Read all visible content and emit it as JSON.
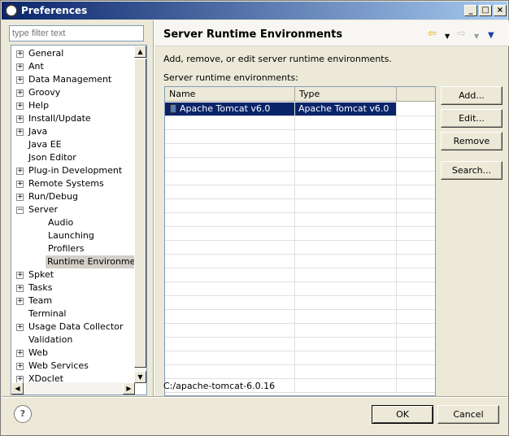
{
  "window": {
    "title": "Preferences",
    "minimize": "_",
    "maximize": "□",
    "close": "×"
  },
  "filter": {
    "placeholder": "type filter text"
  },
  "tree": {
    "items": [
      {
        "label": "General",
        "expander": "+"
      },
      {
        "label": "Ant",
        "expander": "+"
      },
      {
        "label": "Data Management",
        "expander": "+"
      },
      {
        "label": "Groovy",
        "expander": "+"
      },
      {
        "label": "Help",
        "expander": "+"
      },
      {
        "label": "Install/Update",
        "expander": "+"
      },
      {
        "label": "Java",
        "expander": "+"
      },
      {
        "label": "Java EE",
        "expander": ""
      },
      {
        "label": "Json Editor",
        "expander": ""
      },
      {
        "label": "Plug-in Development",
        "expander": "+"
      },
      {
        "label": "Remote Systems",
        "expander": "+"
      },
      {
        "label": "Run/Debug",
        "expander": "+"
      },
      {
        "label": "Server",
        "expander": "−"
      },
      {
        "label": "Audio",
        "expander": ""
      },
      {
        "label": "Launching",
        "expander": ""
      },
      {
        "label": "Profilers",
        "expander": ""
      },
      {
        "label": "Runtime Environments",
        "expander": "",
        "selected": true
      },
      {
        "label": "Spket",
        "expander": "+"
      },
      {
        "label": "Tasks",
        "expander": "+"
      },
      {
        "label": "Team",
        "expander": "+"
      },
      {
        "label": "Terminal",
        "expander": ""
      },
      {
        "label": "Usage Data Collector",
        "expander": "+"
      },
      {
        "label": "Validation",
        "expander": ""
      },
      {
        "label": "Web",
        "expander": "+"
      },
      {
        "label": "Web Services",
        "expander": "+"
      },
      {
        "label": "XDoclet",
        "expander": "+"
      }
    ]
  },
  "page": {
    "title": "Server Runtime Environments",
    "nav": {
      "back": "⇦",
      "back_dropdown": "▼",
      "forward": "⇨",
      "forward_dropdown": "▼",
      "menu": "▼"
    },
    "description": "Add, remove, or edit server runtime environments.",
    "list_label": "Server runtime environments:",
    "table": {
      "columns": [
        "Name",
        "Type",
        ""
      ],
      "rows": [
        {
          "name": "Apache Tomcat v6.0",
          "type": "Apache Tomcat v6.0",
          "selected": true
        }
      ]
    },
    "buttons": {
      "add": "Add...",
      "edit": "Edit...",
      "remove": "Remove",
      "search": "Search..."
    },
    "path": "C:/apache-tomcat-6.0.16"
  },
  "footer": {
    "help": "?",
    "ok": "OK",
    "cancel": "Cancel"
  },
  "colors": {
    "selection": "#0a246a",
    "titlebar": "#0a246a",
    "face": "#ece9d8"
  }
}
